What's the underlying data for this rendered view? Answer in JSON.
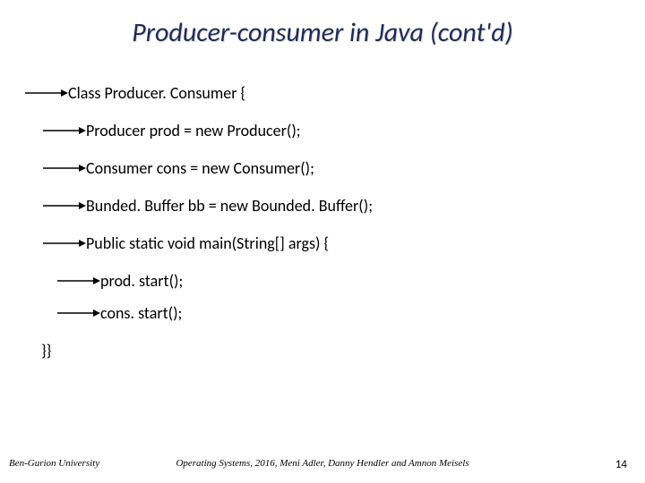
{
  "title": "Producer-consumer in Java (cont'd)",
  "lines": {
    "l0": "Class Producer. Consumer {",
    "l1": "Producer prod = new Producer();",
    "l2": "Consumer cons = new Consumer();",
    "l3": "Bunded. Buffer bb = new Bounded. Buffer();",
    "l4": "Public static void main(String[] args) {",
    "l5": "prod. start();",
    "l6": "cons. start();",
    "l7": "}}"
  },
  "footer": {
    "left": "Ben-Gurion University",
    "center": "Operating Systems, 2016, Meni Adler, Danny Hendler and Amnon Meisels",
    "right": "14"
  }
}
